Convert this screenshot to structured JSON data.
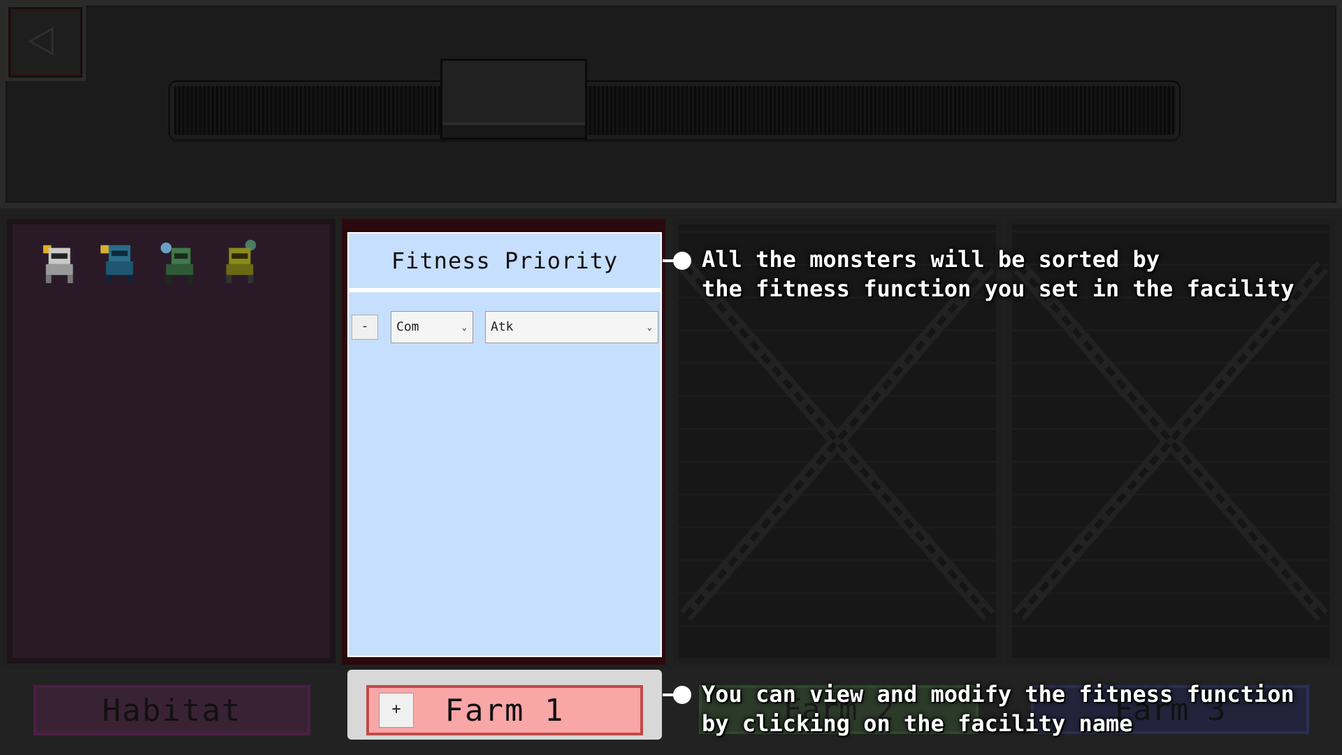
{
  "fitness_panel": {
    "title": "Fitness Priority",
    "remove_label": "-",
    "select_left": "Com",
    "select_right": "Atk",
    "chevron": "⌄"
  },
  "tabs": {
    "habitat": "Habitat",
    "farm1": "Farm 1",
    "farm2": "Farm 2",
    "farm3": "Farm 3",
    "add_label": "+"
  },
  "tooltips": {
    "top_line1": "All the monsters will be sorted by",
    "top_line2": "the fitness function you set in the facility",
    "bottom_line1": "You can view and modify the fitness function",
    "bottom_line2": "by clicking on the facility name"
  },
  "monsters": [
    {
      "name": "monster-white",
      "color": "#c9c9c9",
      "accent": "#e0b020"
    },
    {
      "name": "monster-blue",
      "color": "#2a6e8a",
      "accent": "#d8b030"
    },
    {
      "name": "monster-green",
      "color": "#3f7a4a",
      "accent": "#6aa0c0"
    },
    {
      "name": "monster-yellow",
      "color": "#8a8a1e",
      "accent": "#4a7a6a"
    }
  ],
  "colors": {
    "habitat": "#3a2235",
    "farm1": "#f9a6a6",
    "farm2": "#2c3a2a",
    "farm3": "#23243c",
    "fitness_panel": "#c6dffd"
  }
}
